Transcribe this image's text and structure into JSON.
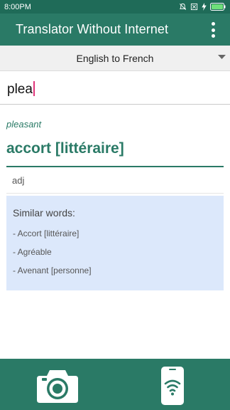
{
  "status": {
    "time": "8:00PM",
    "icons": [
      "notifications-off-icon",
      "sim-icon",
      "charging-icon",
      "battery-icon"
    ]
  },
  "app_bar": {
    "title": "Translator Without Internet",
    "menu_icon": "more-vert-icon"
  },
  "language": {
    "selected": "English to French"
  },
  "search": {
    "value": "plea"
  },
  "result": {
    "source_word": "pleasant",
    "translation": "accort [littéraire]",
    "part_of_speech": "adj",
    "similar_title": "Similar words:",
    "similar_words": [
      "- Accort [littéraire]",
      "- Agréable",
      "- Avenant [personne]"
    ]
  },
  "bottom_bar": {
    "left_icon": "camera-icon",
    "right_icon": "phone-wifi-icon"
  },
  "colors": {
    "primary": "#2a7a66",
    "status_bar": "#1f6b58",
    "similar_background": "#dce8fb",
    "cursor": "#e0357a"
  }
}
